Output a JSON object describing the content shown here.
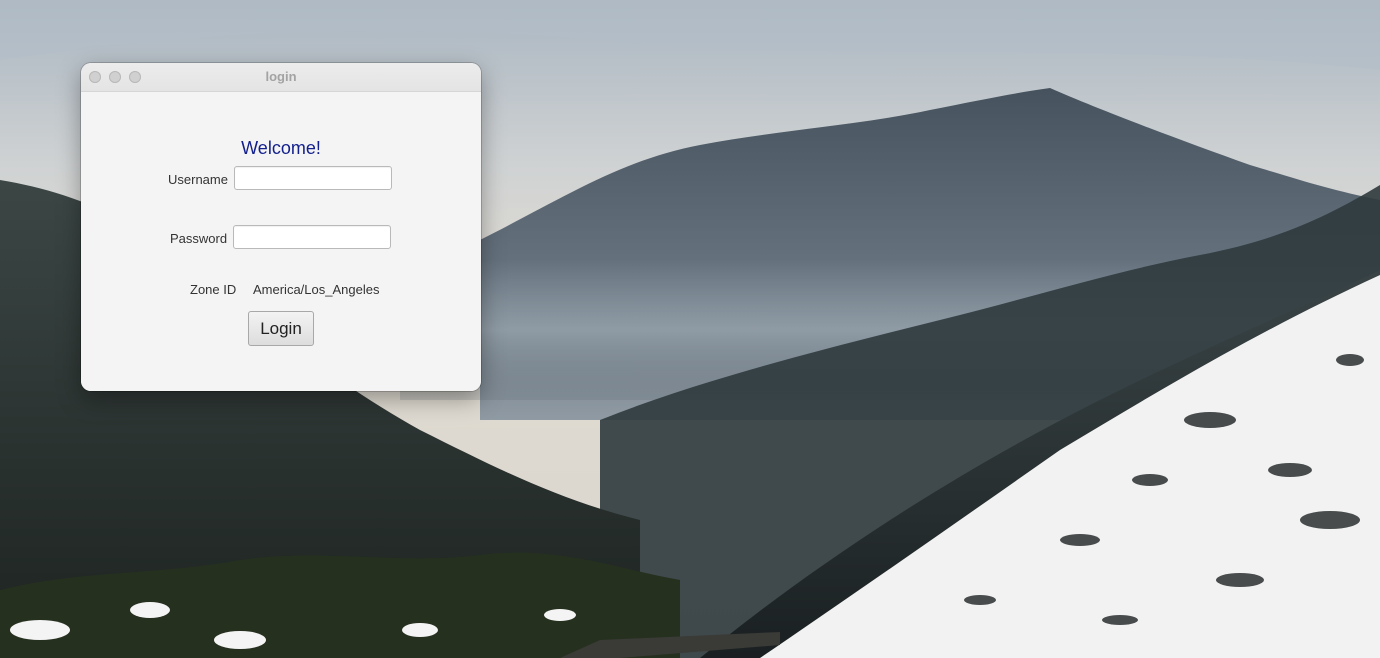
{
  "window": {
    "title": "login"
  },
  "form": {
    "welcome_text": "Welcome!",
    "username_label": "Username",
    "username_value": "",
    "password_label": "Password",
    "password_value": "",
    "zone_label": "Zone ID",
    "zone_value": "America/Los_Angeles",
    "login_button_label": "Login"
  },
  "colors": {
    "welcome_text": "#121f8c",
    "window_background": "#f4f4f4",
    "title_text": "#a3a3a3"
  },
  "icons": {
    "close": "close-icon",
    "minimize": "minimize-icon",
    "zoom": "zoom-icon"
  }
}
